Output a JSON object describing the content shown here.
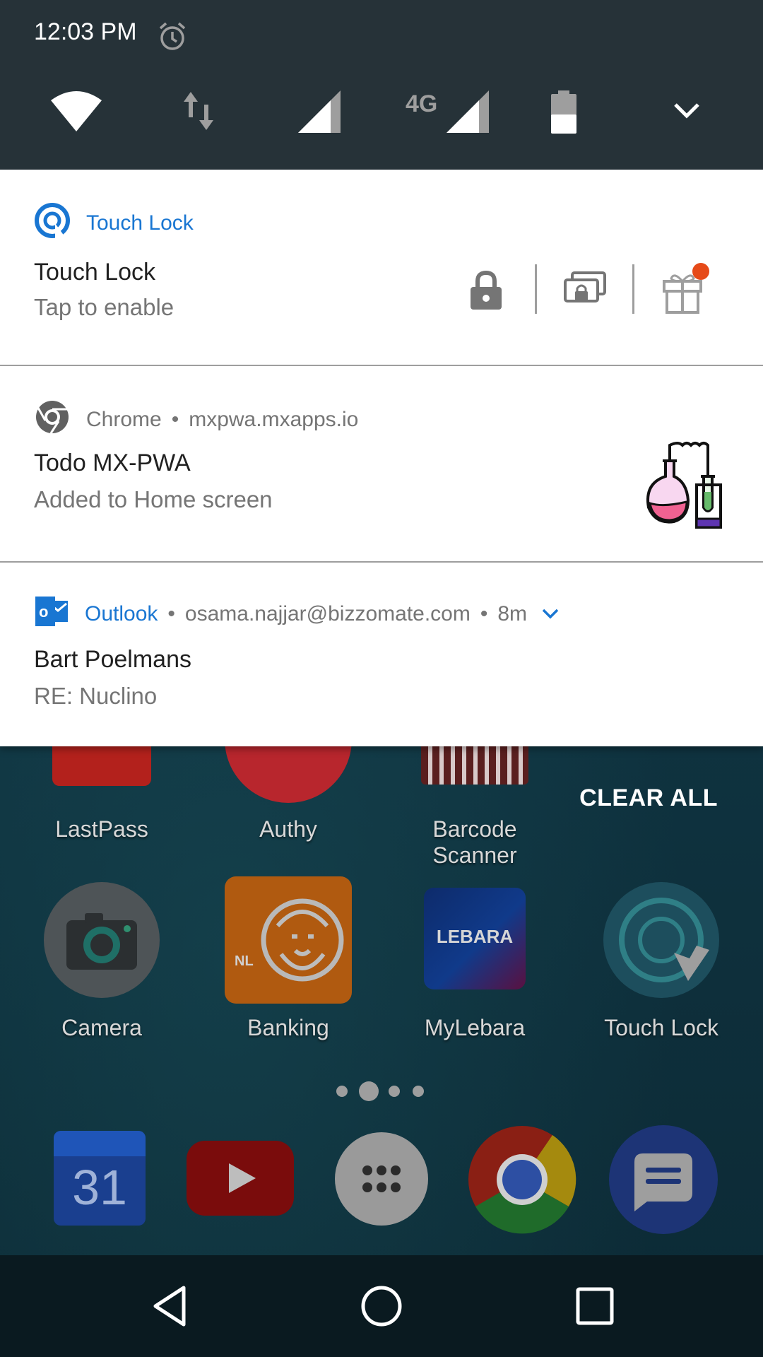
{
  "status_bar": {
    "time": "12:03 PM",
    "icons": [
      "alarm-icon"
    ]
  },
  "quick_settings": {
    "tiles": [
      "wifi-icon",
      "data-transfer-icon",
      "cell-signal-icon",
      "4g-signal-icon",
      "battery-icon",
      "expand-chevron-icon"
    ],
    "network_label": "4G"
  },
  "notifications": [
    {
      "app_name": "Touch Lock",
      "app_icon": "touch-lock-icon",
      "title": "Touch Lock",
      "text": "Tap to enable",
      "actions": [
        "lock-icon",
        "screens-lock-icon",
        "gift-icon"
      ],
      "accent": "#1976d2"
    },
    {
      "app_name": "Chrome",
      "source": "mxpwa.mxapps.io",
      "app_icon": "chrome-icon",
      "title": "Todo MX-PWA",
      "text": "Added to Home screen",
      "large_icon": "chemistry-flasks-icon"
    },
    {
      "app_name": "Outlook",
      "account": "osama.najjar@bizzomate.com",
      "time_ago": "8m",
      "app_icon": "outlook-icon",
      "title": "Bart Poelmans",
      "text": "RE: Nuclino"
    }
  ],
  "clear_all_label": "CLEAR ALL",
  "home_screen": {
    "row1": [
      "LastPass",
      "Authy",
      "Barcode Scanner"
    ],
    "row2": [
      "Camera",
      "Banking",
      "MyLebara",
      "Touch Lock"
    ],
    "banking_badge": "NL",
    "lebara_logo": "LEBARA",
    "calendar_day": "31",
    "dock": [
      "calendar-icon",
      "youtube-icon",
      "app-drawer-icon",
      "chrome-icon",
      "messages-icon"
    ]
  },
  "nav_bar": [
    "back-icon",
    "home-icon",
    "recents-icon"
  ]
}
